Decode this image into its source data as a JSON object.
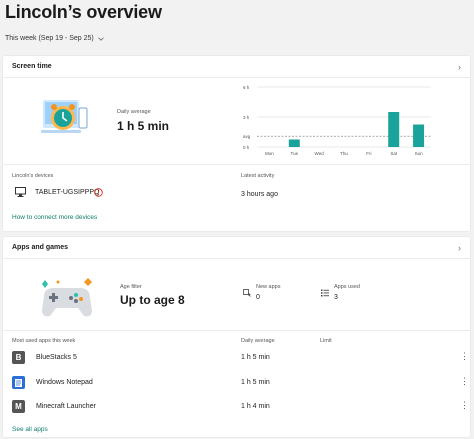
{
  "page": {
    "title": "Lincoln’s overview",
    "week_selector": "This week (Sep 19 - Sep 25)"
  },
  "screen_time": {
    "header": "Screen time",
    "avg_label": "Daily average",
    "avg_value": "1 h 5 min",
    "devices_label": "Lincoln's devices",
    "device_name": "TABLET-UGSIPPPQ",
    "last_activity_label": "Latest activity",
    "last_activity_value": "3 hours ago",
    "connect_link": "How to connect more devices"
  },
  "chart_data": {
    "type": "bar",
    "categories": [
      "Mon",
      "Tue",
      "Wed",
      "Thu",
      "Fri",
      "Sat",
      "Sun"
    ],
    "values": [
      0,
      0.75,
      0,
      0,
      0,
      3.5,
      2.25
    ],
    "average": 1.08,
    "y_ticks": [
      "6 h",
      "3 h",
      "avg",
      "0 h"
    ],
    "ylim": [
      0,
      6
    ],
    "color": "#1aa39a"
  },
  "apps": {
    "header": "Apps and games",
    "age_filter_label": "Age filter",
    "age_filter_value": "Up to age 8",
    "new_apps_label": "New apps",
    "new_apps_value": "0",
    "apps_used_label": "Apps used",
    "apps_used_value": "3",
    "col_most_used": "Most used apps this week",
    "col_daily_avg": "Daily average",
    "col_limit": "Limit",
    "list": [
      {
        "name": "BlueStacks 5",
        "avg": "1 h 5 min",
        "icon": "B",
        "icon_color": "#555555"
      },
      {
        "name": "Windows Notepad",
        "avg": "1 h 5 min",
        "icon": "notepad",
        "icon_color": "#2b6fd6"
      },
      {
        "name": "Minecraft Launcher",
        "avg": "1 h 4 min",
        "icon": "M",
        "icon_color": "#555555"
      }
    ],
    "see_all": "See all apps"
  },
  "colors": {
    "accent": "#0f7b6c",
    "bar": "#1aa39a",
    "warning": "#c42b1c"
  }
}
